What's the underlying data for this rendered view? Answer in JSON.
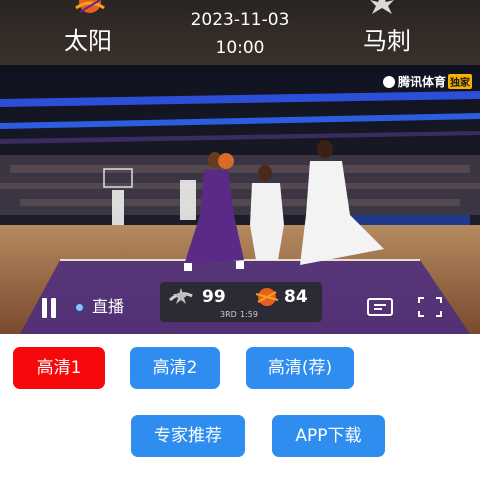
{
  "header": {
    "home_team": "太阳",
    "away_team": "马刺",
    "date": "2023-11-03",
    "time": "10:00"
  },
  "player": {
    "watermark": "腾讯体育",
    "watermark_badge": "独家",
    "live_label": "直播",
    "scorebug": {
      "away_score": "99",
      "home_score": "84",
      "period": "3RD",
      "clock": "1:59"
    },
    "icons": [
      "pause-icon",
      "live-dot-icon",
      "pip-icon",
      "fullscreen-icon",
      "suns-logo",
      "spurs-logo"
    ]
  },
  "buttons": {
    "hd1": "高清1",
    "hd2": "高清2",
    "hd3": "高清(荐)",
    "expert": "专家推荐",
    "app": "APP下载"
  },
  "colors": {
    "active_button": "#f5090b",
    "button": "#2f8df0",
    "header_bg": "#2a2522"
  }
}
